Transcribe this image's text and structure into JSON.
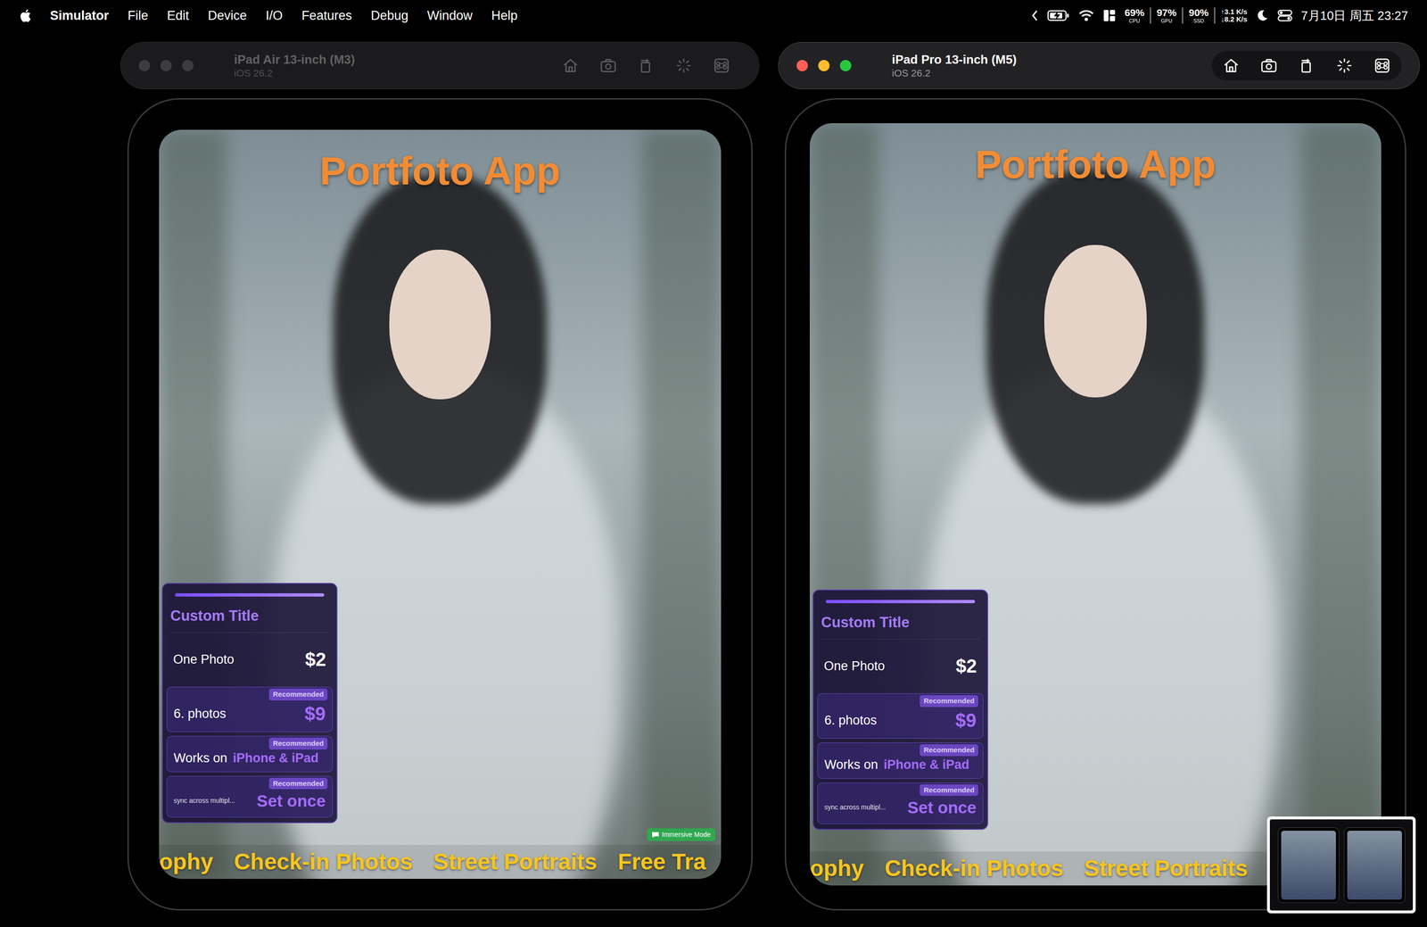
{
  "menubar": {
    "app": "Simulator",
    "menus": [
      "File",
      "Edit",
      "Device",
      "I/O",
      "Features",
      "Debug",
      "Window",
      "Help"
    ],
    "stats": [
      {
        "value": "69%",
        "label": "CPU"
      },
      {
        "value": "97%",
        "label": "GPU"
      },
      {
        "value": "90%",
        "label": "SSD"
      }
    ],
    "network": {
      "up": "↑3.1 K/s",
      "down": "↓8.2 K/s"
    },
    "clock": "7月10日 周五 23:27"
  },
  "windows": [
    {
      "title": "iPad Air 13-inch (M3)",
      "subtitle": "iOS 26.2",
      "active": false,
      "screen": {
        "title": "Portfoto App",
        "card": {
          "title": "Custom Title",
          "rows": [
            {
              "kind": "price",
              "label": "One Photo",
              "value": "$2",
              "recommended": false
            },
            {
              "kind": "price",
              "label": "6. photos",
              "value": "$9",
              "recommended": true,
              "badge": "Recommended"
            },
            {
              "kind": "feature",
              "label": "Works on",
              "value": "iPhone & iPad",
              "recommended": true,
              "badge": "Recommended"
            },
            {
              "kind": "note",
              "label": "sync across multipl...",
              "value": "Set once",
              "recommended": true,
              "badge": "Recommended"
            }
          ]
        },
        "marquee": [
          "ophy",
          "Check-in Photos",
          "Street Portraits",
          "Free Tra"
        ],
        "badge": "Immersive Mode"
      }
    },
    {
      "title": "iPad Pro 13-inch (M5)",
      "subtitle": "iOS 26.2",
      "active": true,
      "screen": {
        "title": "Portfoto App",
        "card": {
          "title": "Custom Title",
          "rows": [
            {
              "kind": "price",
              "label": "One Photo",
              "value": "$2",
              "recommended": false
            },
            {
              "kind": "price",
              "label": "6. photos",
              "value": "$9",
              "recommended": true,
              "badge": "Recommended"
            },
            {
              "kind": "feature",
              "label": "Works on",
              "value": "iPhone & iPad",
              "recommended": true,
              "badge": "Recommended"
            },
            {
              "kind": "note",
              "label": "sync across multipl...",
              "value": "Set once",
              "recommended": true,
              "badge": "Recommended"
            }
          ]
        },
        "marquee": [
          "ophy",
          "Check-in Photos",
          "Street Portraits"
        ]
      }
    }
  ]
}
